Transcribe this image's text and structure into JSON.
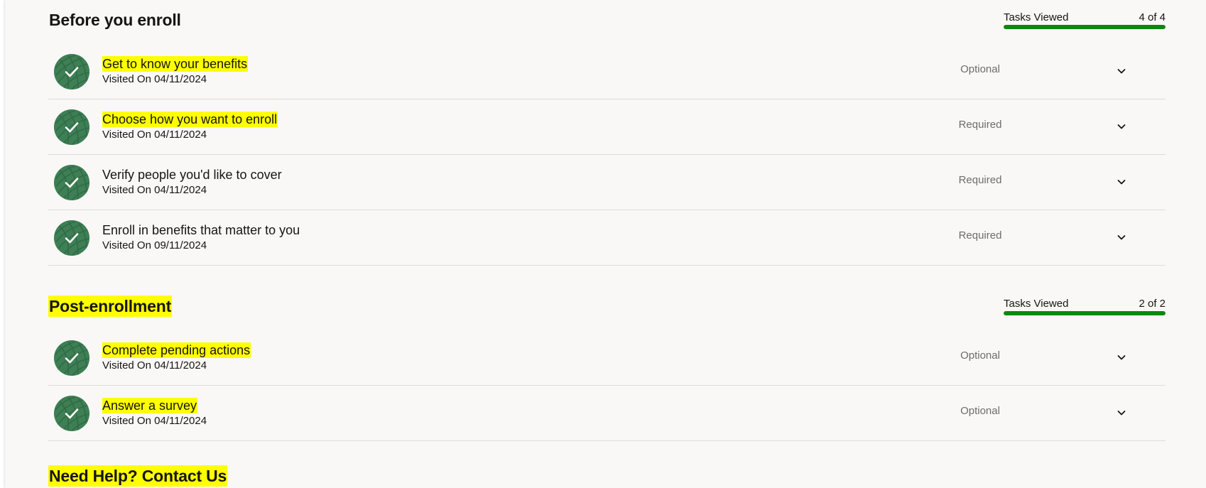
{
  "sections": [
    {
      "title": "Before you enroll",
      "progress": {
        "label": "Tasks Viewed",
        "count": "4 of 4",
        "fraction": 1.0
      },
      "tasks": [
        {
          "title": "Get to know your benefits",
          "subtitle": "Visited On 04/11/2024",
          "status": "Optional",
          "icon": "check-icon"
        },
        {
          "title": "Choose how you want to enroll",
          "subtitle": "Visited On 04/11/2024",
          "status": "Required",
          "icon": "check-icon"
        },
        {
          "title": "Verify people you'd like to cover",
          "subtitle": "Visited On 04/11/2024",
          "status": "Required",
          "icon": "check-icon"
        },
        {
          "title": "Enroll in benefits that matter to you",
          "subtitle": "Visited On 09/11/2024",
          "status": "Required",
          "icon": "check-icon"
        }
      ]
    },
    {
      "title": "Post-enrollment",
      "progress": {
        "label": "Tasks Viewed",
        "count": "2 of 2",
        "fraction": 1.0
      },
      "tasks": [
        {
          "title": "Complete pending actions",
          "subtitle": "Visited On 04/11/2024",
          "status": "Optional",
          "icon": "check-icon"
        },
        {
          "title": "Answer a survey",
          "subtitle": "Visited On 04/11/2024",
          "status": "Optional",
          "icon": "check-icon"
        }
      ]
    }
  ],
  "help": {
    "title": "Need Help? Contact Us"
  },
  "colors": {
    "progress_fill": "#0a8a0a",
    "badge": "#3e7f55",
    "highlight": "#ffff00"
  }
}
